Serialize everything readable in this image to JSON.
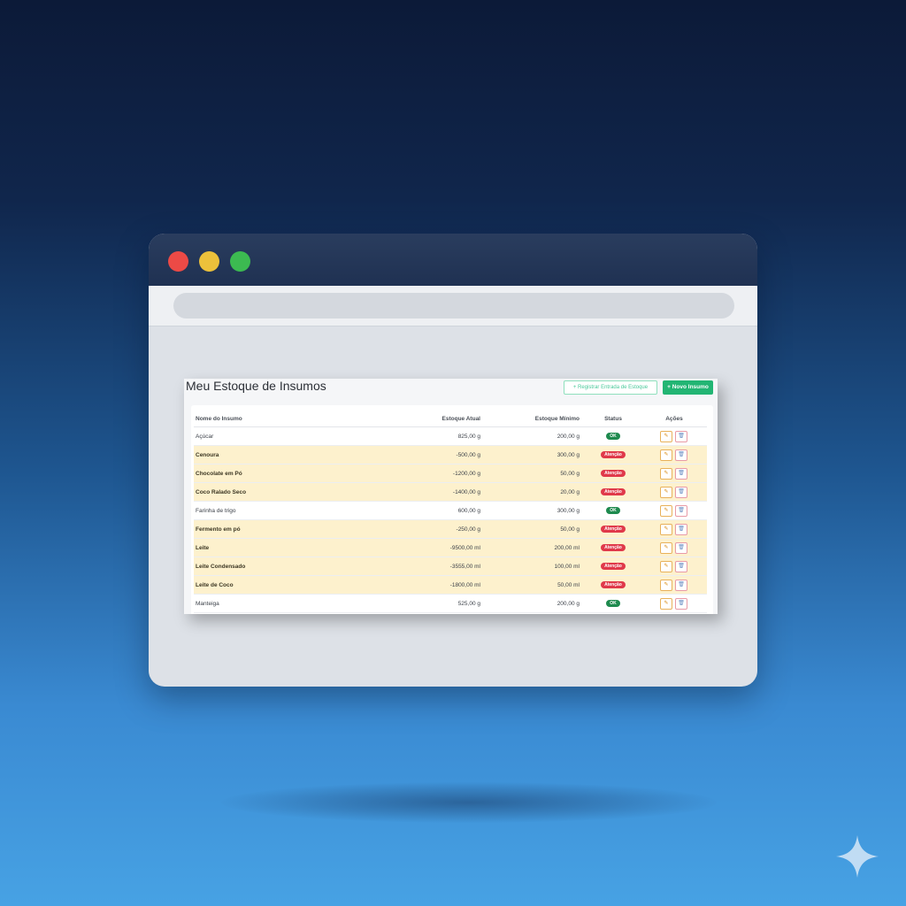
{
  "page": {
    "title": "Meu Estoque de Insumos",
    "register_button": "+ Registrar Entrada de Estoque",
    "new_button": "+ Novo Insumo"
  },
  "table": {
    "headers": {
      "name": "Nome do Insumo",
      "current": "Estoque Atual",
      "minimum": "Estoque Mínimo",
      "status": "Status",
      "actions": "Ações"
    },
    "rows": [
      {
        "name": "Açúcar",
        "current": "825,00 g",
        "minimum": "200,00 g",
        "status": "OK",
        "status_type": "ok"
      },
      {
        "name": "Cenoura",
        "current": "-500,00 g",
        "minimum": "300,00 g",
        "status": "Atenção",
        "status_type": "alert"
      },
      {
        "name": "Chocolate em Pó",
        "current": "-1200,00 g",
        "minimum": "50,00 g",
        "status": "Atenção",
        "status_type": "alert"
      },
      {
        "name": "Coco Ralado Seco",
        "current": "-1400,00 g",
        "minimum": "20,00 g",
        "status": "Atenção",
        "status_type": "alert"
      },
      {
        "name": "Farinha de trigo",
        "current": "600,00 g",
        "minimum": "300,00 g",
        "status": "OK",
        "status_type": "ok"
      },
      {
        "name": "Fermento em pó",
        "current": "-250,00 g",
        "minimum": "50,00 g",
        "status": "Atenção",
        "status_type": "alert"
      },
      {
        "name": "Leite",
        "current": "-9500,00 ml",
        "minimum": "200,00 ml",
        "status": "Atenção",
        "status_type": "alert"
      },
      {
        "name": "Leite Condensado",
        "current": "-3555,00 ml",
        "minimum": "100,00 ml",
        "status": "Atenção",
        "status_type": "alert"
      },
      {
        "name": "Leite de Coco",
        "current": "-1800,00 ml",
        "minimum": "50,00 ml",
        "status": "Atenção",
        "status_type": "alert"
      },
      {
        "name": "Manteiga",
        "current": "525,00 g",
        "minimum": "200,00 g",
        "status": "OK",
        "status_type": "ok"
      }
    ]
  },
  "icons": {
    "edit": "pencil-icon",
    "delete": "trash-icon"
  },
  "colors": {
    "ok": "#1e8a4e",
    "alert": "#e0394a",
    "warn_row": "#fdf1cd",
    "primary_button": "#22b573"
  }
}
